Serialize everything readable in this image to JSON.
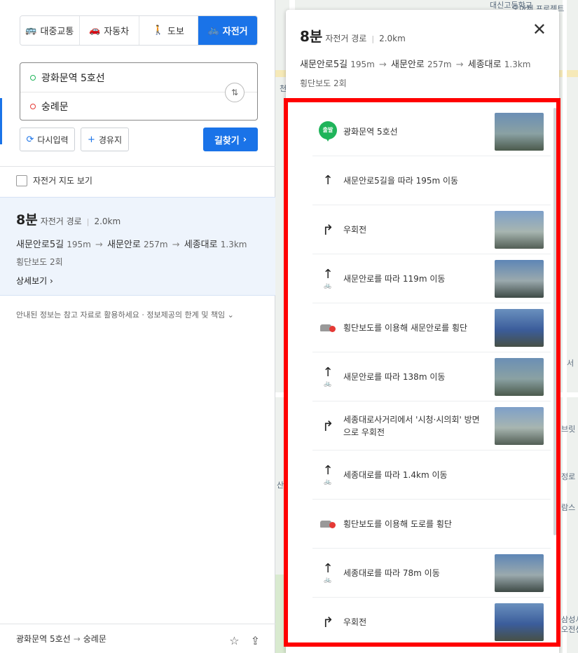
{
  "modes": [
    {
      "label": "대중교통",
      "icon": "bus-icon",
      "glyph": "🚌",
      "active": false
    },
    {
      "label": "자동차",
      "icon": "car-icon",
      "glyph": "🚗",
      "active": false
    },
    {
      "label": "도보",
      "icon": "walk-icon",
      "glyph": "🚶",
      "active": false
    },
    {
      "label": "자전거",
      "icon": "bicycle-icon",
      "glyph": "🚲",
      "active": true
    }
  ],
  "route": {
    "origin": "광화문역 5호선",
    "destination": "숭례문"
  },
  "buttons": {
    "reset": "다시입력",
    "waypoint": "경유지",
    "search": "길찾기"
  },
  "bike_map_label": "자전거 지도 보기",
  "summary": {
    "time": "8분",
    "route_type": "자전거 경로",
    "distance": "2.0km",
    "segments": [
      {
        "name": "새문안로5길",
        "dist": "195m"
      },
      {
        "name": "새문안로",
        "dist": "257m"
      },
      {
        "name": "세종대로",
        "dist": "1.3km"
      }
    ],
    "crosswalk": "횡단보도 2회",
    "detail_link": "상세보기"
  },
  "notice": "안내된 정보는 참고 자료로 활용하세요 · 정보제공의 한계 및 책임",
  "bottom": {
    "from": "광화문역 5호선",
    "to": "숭례문"
  },
  "steps": [
    {
      "type": "start",
      "text": "광화문역 5호선",
      "pin_label": "출발",
      "thumb": true
    },
    {
      "type": "straight",
      "text": "새문안로5길을 따라 195m 이동",
      "thumb": false,
      "bike": false
    },
    {
      "type": "right",
      "text": "우회전",
      "thumb": true
    },
    {
      "type": "straight",
      "text": "새문안로를 따라 119m 이동",
      "thumb": true,
      "bike": true
    },
    {
      "type": "cross",
      "text": "횡단보도를 이용해 새문안로를 횡단",
      "thumb": true
    },
    {
      "type": "straight",
      "text": "새문안로를 따라 138m 이동",
      "thumb": true,
      "bike": true
    },
    {
      "type": "right",
      "text": "세종대로사거리에서 '시청·시의회' 방면으로 우회전",
      "thumb": true
    },
    {
      "type": "straight",
      "text": "세종대로를 따라 1.4km 이동",
      "thumb": false,
      "bike": true
    },
    {
      "type": "cross",
      "text": "횡단보도를 이용해 도로를 횡단",
      "thumb": false
    },
    {
      "type": "straight",
      "text": "세종대로를 따라 78m 이동",
      "thumb": true,
      "bike": true
    },
    {
      "type": "right",
      "text": "우회전",
      "thumb": true
    }
  ],
  "map_labels": [
    "대신고등학교",
    "오아제 프로젝트",
    "천",
    "서",
    "정로",
    "브릿",
    "람스",
    "삼성서",
    "오전센",
    "산"
  ]
}
